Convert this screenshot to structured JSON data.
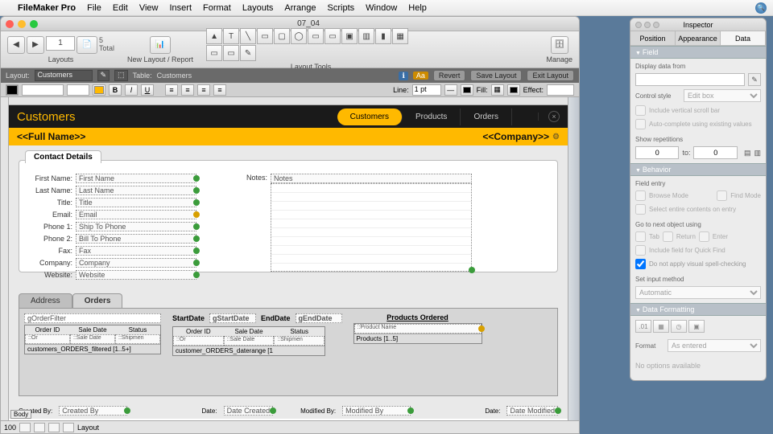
{
  "menubar": {
    "app": "FileMaker Pro",
    "items": [
      "File",
      "Edit",
      "View",
      "Insert",
      "Format",
      "Layouts",
      "Arrange",
      "Scripts",
      "Window",
      "Help"
    ]
  },
  "window": {
    "title": "07_04"
  },
  "toolbar": {
    "page": "1",
    "totalPages": "5",
    "total_label": "Total",
    "layouts_label": "Layouts",
    "newlayout_label": "New Layout / Report",
    "layouttools_label": "Layout Tools",
    "manage_label": "Manage"
  },
  "layoutbar": {
    "layout_label": "Layout:",
    "layout_value": "Customers",
    "table_label": "Table:",
    "table_value": "Customers",
    "revert": "Revert",
    "save": "Save Layout",
    "exit": "Exit Layout"
  },
  "formatbar": {
    "line_label": "Line:",
    "line_value": "1 pt",
    "fill_label": "Fill:",
    "effect_label": "Effect:"
  },
  "header": {
    "title": "Customers",
    "tabs": [
      "Customers",
      "Products",
      "Orders"
    ],
    "fullname": "<<Full Name>>",
    "company": "<<Company>>"
  },
  "contact": {
    "tab": "Contact Details",
    "first_name_l": "First Name:",
    "first_name": "First Name",
    "last_name_l": "Last Name:",
    "last_name": "Last Name",
    "title_l": "Title:",
    "title": "Title",
    "email_l": "Email:",
    "email": "Email",
    "phone1_l": "Phone 1:",
    "phone1": "Ship To Phone",
    "phone2_l": "Phone 2:",
    "phone2": "Bill To Phone",
    "fax_l": "Fax:",
    "fax": "Fax",
    "company_l": "Company:",
    "company": "Company",
    "website_l": "Website:",
    "website": "Website",
    "notes_l": "Notes:",
    "notes": "Notes"
  },
  "subtabs": {
    "address": "Address",
    "orders": "Orders"
  },
  "orders": {
    "filter_field": "gOrderFilter",
    "cols": [
      "Order ID",
      "Sale Date",
      "Status"
    ],
    "row": [
      "::Or",
      "::Sale Date",
      "::Shipmen"
    ],
    "portal1_label": "customers_ORDERS_filtered [1..5+]",
    "start_l": "StartDate",
    "start": "gStartDate",
    "end_l": "EndDate",
    "end": "gEndDate",
    "portal2_label": "customer_ORDERS_daterange [1",
    "products_head": "Products Ordered",
    "products_field": "::Product Name",
    "products_label": "Products [1..5]"
  },
  "footer": {
    "created_l": "Created By:",
    "created": "Created By",
    "date_l": "Date:",
    "date_c": "Date Created",
    "modified_l": "Modified By:",
    "modified": "Modified By",
    "date_m": "Date Modified"
  },
  "statusbar": {
    "zoom": "100",
    "mode": "Layout",
    "part": "Body"
  },
  "inspector": {
    "title": "Inspector",
    "tabs": [
      "Position",
      "Appearance",
      "Data"
    ],
    "field_sec": "Field",
    "display_label": "Display data from",
    "control_label": "Control style",
    "control_value": "Edit box",
    "cb_scroll": "Include vertical scroll bar",
    "cb_auto": "Auto-complete using existing values",
    "rep_label": "Show repetitions",
    "rep_from": "0",
    "rep_to_l": "to:",
    "rep_to": "0",
    "behavior_sec": "Behavior",
    "entry_label": "Field entry",
    "cb_browse": "Browse Mode",
    "cb_find": "Find Mode",
    "cb_select": "Select entire contents on entry",
    "goto_label": "Go to next object using",
    "cb_tab": "Tab",
    "cb_return": "Return",
    "cb_enter": "Enter",
    "cb_quick": "Include field for Quick Find",
    "cb_spell": "Do not apply visual spell-checking",
    "input_label": "Set input method",
    "input_value": "Automatic",
    "dataf_sec": "Data Formatting",
    "format_label": "Format",
    "format_value": "As entered",
    "noopt": "No options available"
  }
}
